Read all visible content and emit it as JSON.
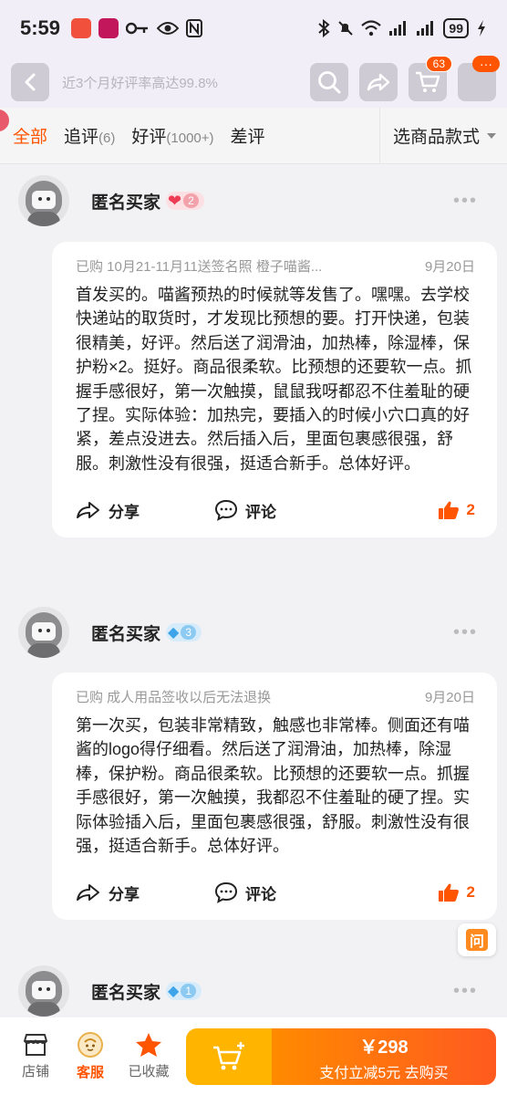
{
  "status_bar": {
    "time": "5:59",
    "battery": "99"
  },
  "header": {
    "title": "近3个月好评率高达99.8%",
    "cart_count": "63",
    "more_badge": "···"
  },
  "tabs": [
    {
      "label": "全部",
      "count": ""
    },
    {
      "label": "追评",
      "count": "(6)"
    },
    {
      "label": "好评",
      "count": "(1000+)"
    },
    {
      "label": "差评",
      "count": ""
    }
  ],
  "style_select": "选商品款式",
  "reviews": [
    {
      "name": "匿名买家",
      "level": "2",
      "level_icon": "heart-icon",
      "sku": "已购 10月21-11月11送签名照 橙子喵酱...",
      "date": "9月20日",
      "text": "首发买的。喵酱预热的时候就等发售了。嘿嘿。去学校快递站的取货时，才发现比预想的要。打开快递，包装很精美，好评。然后送了润滑油，加热棒，除湿棒，保护粉×2。挺好。商品很柔软。比预想的还要软一点。抓握手感很好，第一次触摸，鼠鼠我呀都忍不住羞耻的硬了捏。实际体验：加热完，要插入的时候小穴口真的好紧，差点没进去。然后插入后，里面包裹感很强，舒服。刺激性没有很强，挺适合新手。总体好评。",
      "share": "分享",
      "comment": "评论",
      "likes": "2"
    },
    {
      "name": "匿名买家",
      "level": "3",
      "level_icon": "diamond-icon",
      "sku": "已购 成人用品签收以后无法退换",
      "date": "9月20日",
      "text": "第一次买，包装非常精致，触感也非常棒。侧面还有喵酱的logo得仔细看。然后送了润滑油，加热棒，除湿棒，保护粉。商品很柔软。比预想的还要软一点。抓握手感很好，第一次触摸，我都忍不住羞耻的硬了捏。实际体验插入后，里面包裹感很强，舒服。刺激性没有很强，挺适合新手。总体好评。",
      "share": "分享",
      "comment": "评论",
      "likes": "2"
    },
    {
      "name": "匿名买家",
      "level": "1",
      "level_icon": "diamond-icon"
    }
  ],
  "ask_button": "问",
  "bottom_bar": {
    "shop": "店铺",
    "service": "客服",
    "favorited": "已收藏",
    "price": "￥298",
    "buy_label": "支付立减5元 去购买"
  },
  "colors": {
    "accent": "#ff5500",
    "buy_yellow": "#ffb500",
    "buy_orange": "#ff6a14"
  }
}
